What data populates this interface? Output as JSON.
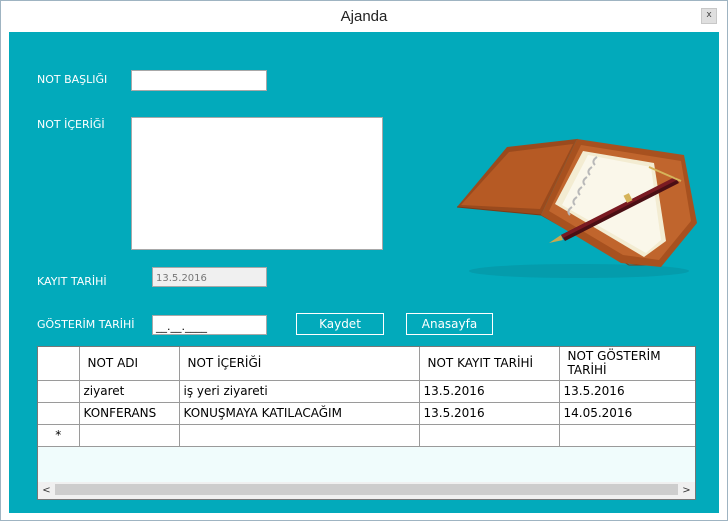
{
  "window": {
    "title": "Ajanda",
    "close_glyph": "x"
  },
  "form": {
    "title_label": "NOT BAŞLIĞI",
    "title_value": "",
    "content_label": "NOT İÇERİĞİ",
    "content_value": "",
    "saved_date_label": "KAYIT TARİHİ",
    "saved_date_value": "13.5.2016",
    "display_date_label": "GÖSTERİM TARİHİ",
    "display_date_value": "__.__.____"
  },
  "buttons": {
    "save": "Kaydet",
    "home": "Anasayfa"
  },
  "grid": {
    "columns": [
      "NOT ADI",
      "NOT İÇERİĞİ",
      "NOT KAYIT TARİHİ",
      "NOT GÖSTERİM TARİHİ"
    ],
    "rows": [
      [
        "ziyaret",
        "iş yeri ziyareti",
        "13.5.2016",
        "13.5.2016"
      ],
      [
        "KONFERANS",
        "KONUŞMAYA KATILACAĞIM",
        "13.5.2016",
        "14.05.2016"
      ]
    ],
    "new_row_marker": "*",
    "scroll_left": "<",
    "scroll_right": ">"
  },
  "colors": {
    "background": "#02aabb",
    "text": "#ffffff"
  },
  "icons": {
    "close": "close-icon",
    "image": "notebook-pen-image"
  }
}
